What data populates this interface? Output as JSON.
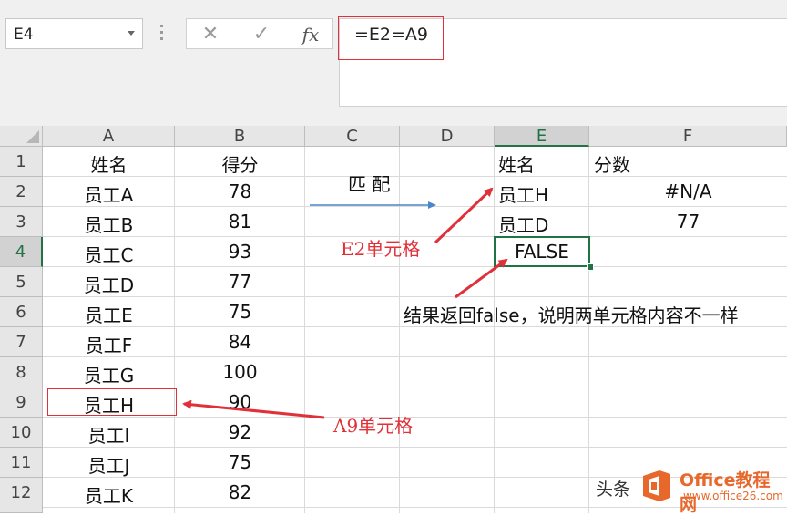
{
  "name_box": "E4",
  "formula": "=E2=A9",
  "fx_label": "fx",
  "columns": [
    "A",
    "B",
    "C",
    "D",
    "E",
    "F"
  ],
  "rows": [
    "1",
    "2",
    "3",
    "4",
    "5",
    "6",
    "7",
    "8",
    "9",
    "10",
    "11",
    "12"
  ],
  "cells": {
    "A1": "姓名",
    "B1": "得分",
    "E1": "姓名",
    "F1": "分数",
    "A2": "员工A",
    "B2": "78",
    "E2": "员工H",
    "F2": "#N/A",
    "A3": "员工B",
    "B3": "81",
    "E3": "员工D",
    "F3": "77",
    "A4": "员工C",
    "B4": "93",
    "E4": "FALSE",
    "A5": "员工D",
    "B5": "77",
    "A6": "员工E",
    "B6": "75",
    "A7": "员工F",
    "B7": "84",
    "A8": "员工G",
    "B8": "100",
    "A9": "员工H",
    "B9": "90",
    "A10": "员工I",
    "B10": "92",
    "A11": "员工J",
    "B11": "75",
    "A12": "员工K",
    "B12": "82"
  },
  "annotations": {
    "match": "匹  配",
    "e2_label": "E2单元格",
    "result": "结果返回false，说明两单元格内容不一样",
    "a9_label": "A9单元格"
  },
  "watermark": {
    "toutiao": "头条",
    "brand": "Office教程网",
    "url": "www.office26.com"
  },
  "colors": {
    "accent_green": "#217346",
    "annotation_red": "#e0303a",
    "arrow_blue": "#4a86c8",
    "watermark_orange": "#e8682c"
  }
}
